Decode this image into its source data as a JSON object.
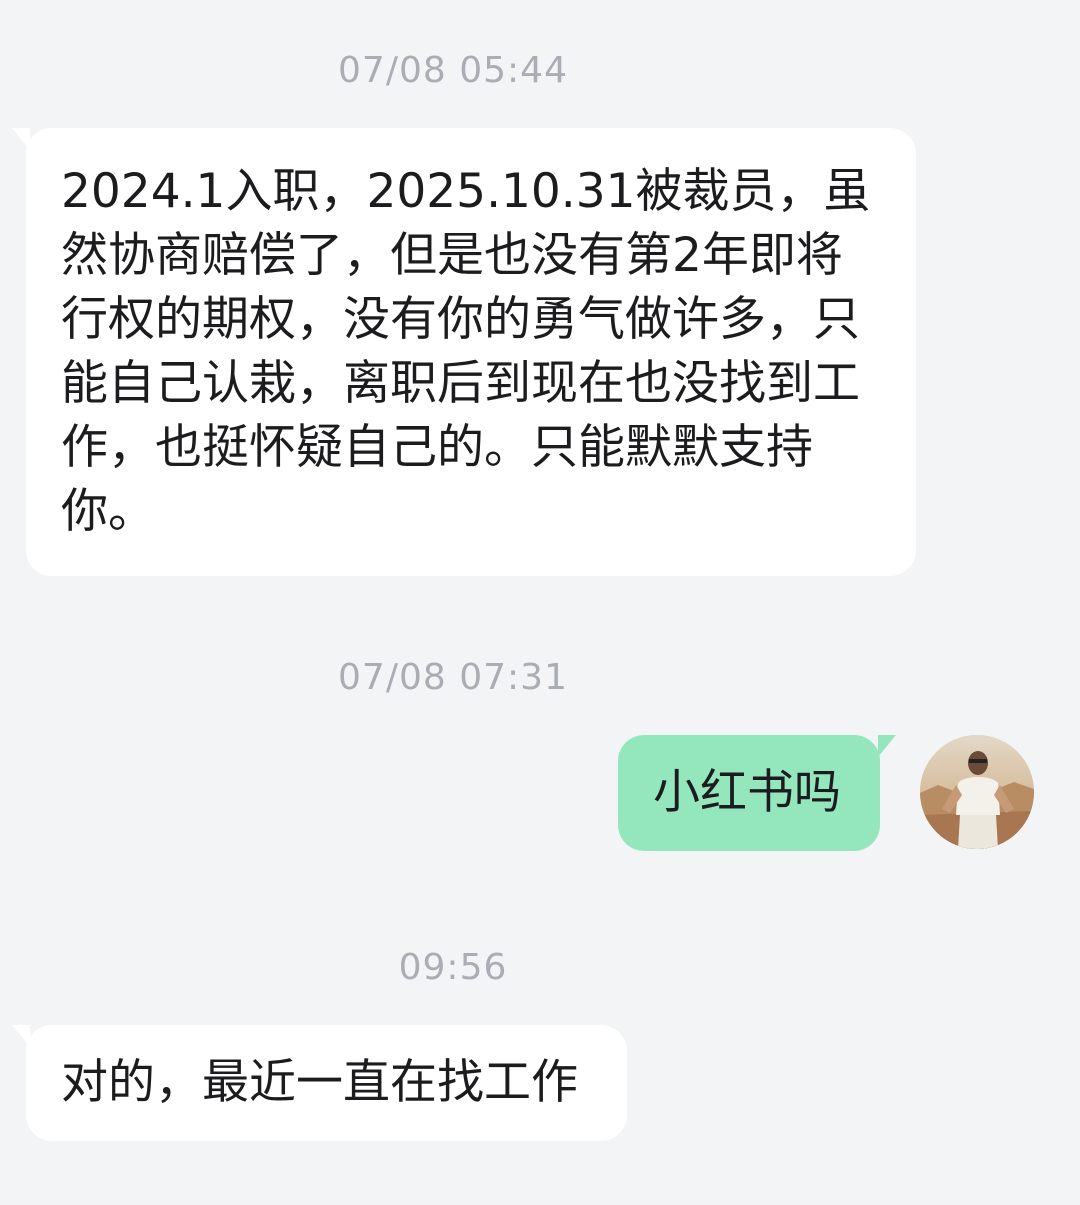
{
  "messages": [
    {
      "timestamp": "07/08 05:44",
      "text": "2024.1入职，2025.10.31被裁员，虽然协商赔偿了，但是也没有第2年即将行权的期权，没有你的勇气做许多，只能自己认栽，离职后到现在也没找到工作，也挺怀疑自己的。只能默默支持你。"
    },
    {
      "timestamp": "07/08 07:31",
      "text": "小红书吗"
    },
    {
      "timestamp": "09:56",
      "text": "对的，最近一直在找工作"
    }
  ],
  "colors": {
    "background": "#f3f4f6",
    "incoming_bubble": "#ffffff",
    "outgoing_bubble": "#94e7bd",
    "timestamp_text": "#a9aeb5"
  },
  "icons": {
    "avatar": "user-avatar-photo"
  }
}
